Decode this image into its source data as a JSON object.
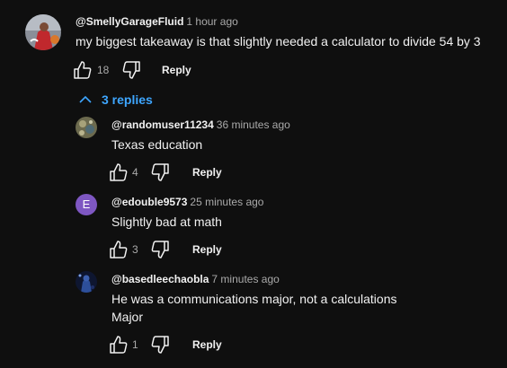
{
  "colors": {
    "background": "#0f0f0f",
    "text": "#f1f1f1",
    "secondary_text": "#aaaaaa",
    "link": "#3ea6ff",
    "letter_avatar_bg": "#7e57c2"
  },
  "top_comment": {
    "author": "@SmellyGarageFluid",
    "time": "1 hour ago",
    "text": "my biggest takeaway is that slightly needed a calculator to divide 54 by 3",
    "likes": "18",
    "like_icon": "thumbs-up-icon",
    "dislike_icon": "thumbs-down-icon",
    "reply_label": "Reply"
  },
  "replies_toggle": {
    "label": "3 replies",
    "icon": "chevron-up-icon"
  },
  "replies": [
    {
      "author": "@randomuser11234",
      "time": "36 minutes ago",
      "text": "Texas education",
      "likes": "4",
      "reply_label": "Reply"
    },
    {
      "author": "@edouble9573",
      "time": "25 minutes ago",
      "text": "Slightly bad at math",
      "likes": "3",
      "reply_label": "Reply",
      "avatar_letter": "E"
    },
    {
      "author": "@basedleechaobla",
      "time": "7 minutes ago",
      "text_line1": "He was a communications major, not a calculations",
      "text_line2": "Major",
      "likes": "1",
      "reply_label": "Reply"
    }
  ]
}
